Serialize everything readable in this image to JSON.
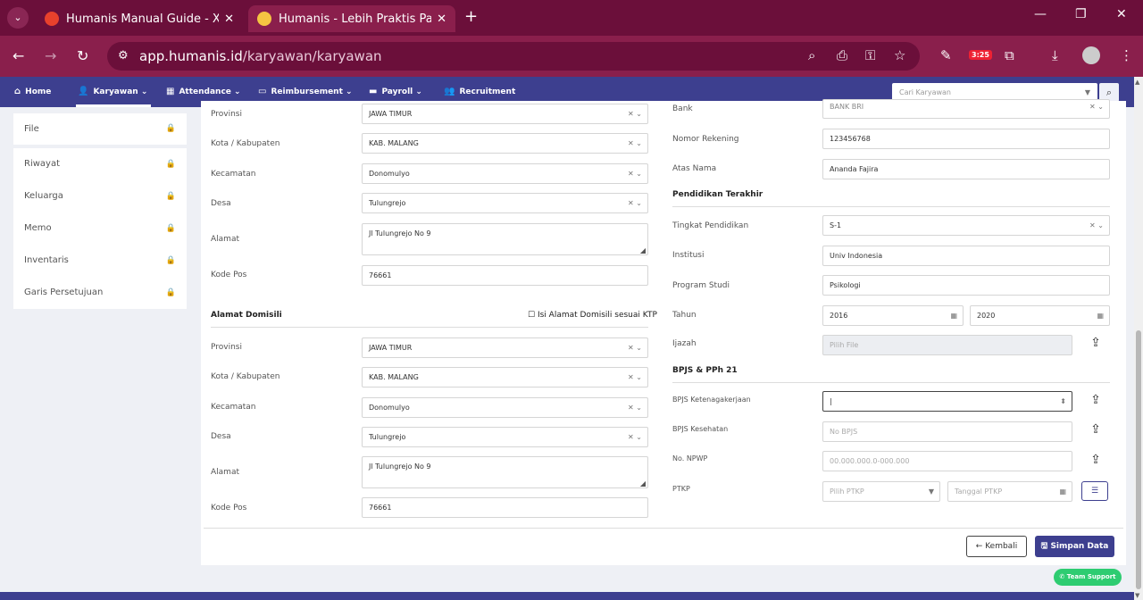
{
  "browser": {
    "tabs": [
      {
        "title": "Humanis Manual Guide - Xmind",
        "fav_color": "#e8412c"
      },
      {
        "title": "Humanis - Lebih Praktis Pakai H",
        "fav_color": "#f5c542"
      }
    ],
    "url_host": "app.humanis.id",
    "url_path": "/karyawan/karyawan",
    "badge": "3:25"
  },
  "nav": {
    "items": [
      "Home",
      "Karyawan",
      "Attendance",
      "Reimbursement",
      "Payroll",
      "Recruitment"
    ],
    "search_placeholder": "Cari Karyawan"
  },
  "sidebar": {
    "top_item": "File",
    "items": [
      "Riwayat",
      "Keluarga",
      "Memo",
      "Inventaris",
      "Garis Persetujuan"
    ]
  },
  "ktp": {
    "provinsi_label": "Provinsi",
    "provinsi": "JAWA TIMUR",
    "kota_label": "Kota / Kabupaten",
    "kota": "KAB. MALANG",
    "kecamatan_label": "Kecamatan",
    "kecamatan": "Donomulyo",
    "desa_label": "Desa",
    "desa": "Tulungrejo",
    "alamat_label": "Alamat",
    "alamat": "Jl Tulungrejo No 9",
    "kodepos_label": "Kode Pos",
    "kodepos": "76661"
  },
  "domisili": {
    "title": "Alamat Domisili",
    "checkbox_label": "Isi Alamat Domisili sesuai KTP",
    "provinsi_label": "Provinsi",
    "provinsi": "JAWA TIMUR",
    "kota_label": "Kota / Kabupaten",
    "kota": "KAB. MALANG",
    "kecamatan_label": "Kecamatan",
    "kecamatan": "Donomulyo",
    "desa_label": "Desa",
    "desa": "Tulungrejo",
    "alamat_label": "Alamat",
    "alamat": "Jl Tulungrejo No 9",
    "kodepos_label": "Kode Pos",
    "kodepos": "76661"
  },
  "bank": {
    "bank_label": "Bank",
    "bank": "BANK BRI",
    "rekening_label": "Nomor Rekening",
    "rekening": "123456768",
    "atas_nama_label": "Atas Nama",
    "atas_nama": "Ananda Fajira"
  },
  "pendidikan": {
    "title": "Pendidikan Terakhir",
    "tingkat_label": "Tingkat Pendidikan",
    "tingkat": "S-1",
    "institusi_label": "Institusi",
    "institusi": "Univ Indonesia",
    "program_label": "Program Studi",
    "program": "Psikologi",
    "tahun_label": "Tahun",
    "tahun_mulai": "2016",
    "tahun_selesai": "2020",
    "ijazah_label": "Ijazah",
    "ijazah_placeholder": "Pilih File"
  },
  "bpjs": {
    "title": "BPJS & PPh 21",
    "ketenagakerjaan_label": "BPJS Ketenagakerjaan",
    "ketenagakerjaan": "",
    "kesehatan_label": "BPJS Kesehatan",
    "kesehatan_placeholder": "No BPJS",
    "npwp_label": "No. NPWP",
    "npwp_placeholder": "00.000.000.0-000.000",
    "ptkp_label": "PTKP",
    "ptkp_placeholder": "Pilih PTKP",
    "tanggal_ptkp_placeholder": "Tanggal PTKP"
  },
  "actions": {
    "back": "Kembali",
    "save": "Simpan Data",
    "support": "Team Support"
  }
}
